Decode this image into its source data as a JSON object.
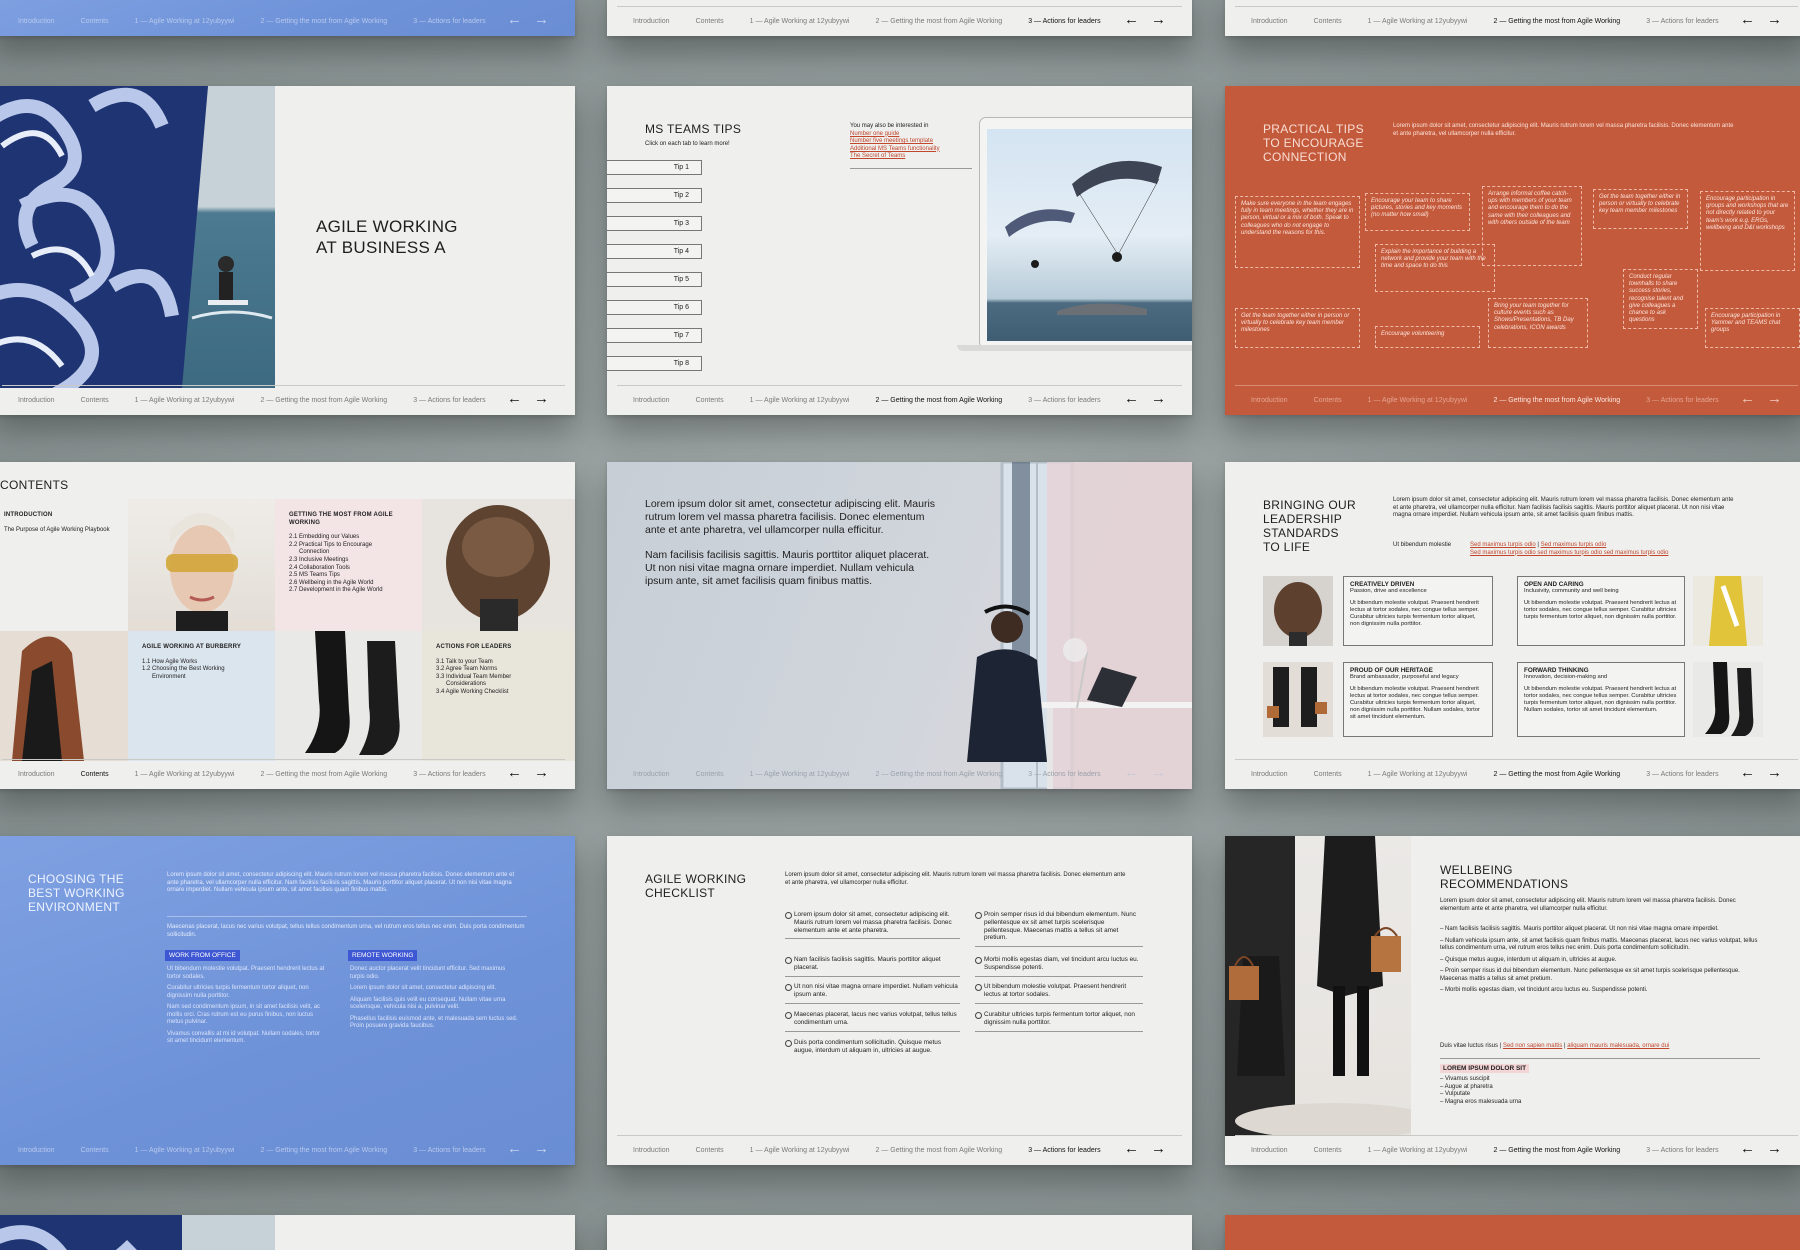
{
  "nav": {
    "items": [
      "Introduction",
      "Contents",
      "1 — Agile Working at 12yubyywi",
      "2 — Getting the most from Agile Working",
      "3 — Actions for leaders"
    ],
    "prev_icon": "arrow-left-icon",
    "next_icon": "arrow-right-icon"
  },
  "colors": {
    "orange": "#c45a3c",
    "blue": "#7496dc",
    "link": "#c0462c"
  },
  "cover": {
    "title_line1": "AGILE WORKING",
    "title_line2": "AT BUSINESS A"
  },
  "teams": {
    "title": "MS TEAMS TIPS",
    "subtitle": "Click on each tab to learn more!",
    "tips": [
      "Tip 1",
      "Tip 2",
      "Tip 3",
      "Tip 4",
      "Tip 5",
      "Tip 6",
      "Tip 7",
      "Tip 8"
    ],
    "interest_label": "You may also be interested in",
    "links": [
      "Number one guide",
      "Number five meetings template",
      "Additional MS Teams functionality",
      "The Secret of Teams"
    ]
  },
  "practical": {
    "title_line1": "PRACTICAL TIPS",
    "title_line2": "TO ENCOURAGE",
    "title_line3": "CONNECTION",
    "intro": "Lorem ipsum dolor sit amet, consectetur adipiscing elit. Mauris rutrum lorem vel massa pharetra facilisis. Donec elementum ante et ante pharetra, vel ullamcorper nulla efficitur.",
    "boxes": [
      "Make sure everyone in the team engages fully in team meetings, whether they are in person, virtual or a mix of both. Speak to colleagues who do not engage to understand the reasons for this.",
      "Encourage your team to share pictures, stories and key moments (no matter how small)",
      "Arrange informal coffee catch-ups with members of your team and encourage them to do the same with their colleagues and with others outside of the team",
      "Get the team together either in person or virtually to celebrate key team member milestones",
      "Encourage participation in groups and workshops that are not directly related to your team's work e.g. ERGs, wellbeing and D&I workshops",
      "Explain the importance of building a network and provide your team with the time and space to do this",
      "Conduct regular townhalls to share success stories, recognise talent and give colleagues a chance to ask questions",
      "Get the team together either in person or virtually to celebrate key team member milestones",
      "Bring your team together for culture events such as Shows/Presentations, TB Day celebrations, ICON awards",
      "Encourage volunteering",
      "Encourage participation in Yammer and TEAMS chat groups"
    ]
  },
  "contents": {
    "title": "CONTENTS",
    "intro_head": "INTRODUCTION",
    "intro_items": [
      "The Purpose of Agile Working Playbook"
    ],
    "getting_head": "GETTING THE MOST FROM AGILE WORKING",
    "getting_items": [
      "2.1 Embedding our Values",
      "2.2 Practical Tips to Encourage",
      "Connection",
      "2.3 Inclusive Meetings",
      "2.4 Collaboration Tools",
      "2.5 MS Teams Tips",
      "2.6 Wellbeing in the Agile World",
      "2.7 Development in the Agile World"
    ],
    "agile_head": "AGILE WORKING AT BURBERRY",
    "agile_items": [
      "1.1 How Agile Works",
      "1.2 Choosing the Best Working",
      "Environment"
    ],
    "actions_head": "ACTIONS FOR LEADERS",
    "actions_items": [
      "3.1 Talk to your Team",
      "3.2 Agree Team Norms",
      "3.3 Individual Team Member",
      "Considerations",
      "3.4 Agile Working Checklist"
    ]
  },
  "quote": {
    "p1": "Lorem ipsum dolor sit amet, consectetur adipiscing elit. Mauris rutrum lorem vel massa pharetra facilisis. Donec elementum ante et ante pharetra, vel ullamcorper nulla efficitur.",
    "p2": "Nam facilisis facilisis sagittis. Mauris porttitor aliquet placerat. Ut non nisi vitae magna ornare imperdiet. Nullam vehicula ipsum ante, sit amet facilisis quam finibus mattis."
  },
  "leadership": {
    "title_line1": "BRINGING OUR",
    "title_line2": "LEADERSHIP",
    "title_line3": "STANDARDS",
    "title_line4": "TO LIFE",
    "intro": "Lorem ipsum dolor sit amet, consectetur adipiscing elit. Mauris rutrum lorem vel massa pharetra facilisis. Donec elementum ante et ante pharetra, vel ullamcorper nulla efficitur. Nam facilisis facilisis sagittis. Mauris porttitor aliquet placerat. Ut non nisi vitae magna ornare imperdiet. Nullam vehicula ipsum ante, sit amet facilisis quam finibus mattis.",
    "ref_label": "Ut bibendum molestie",
    "links": [
      "Sed maximus turpis odio",
      "Sed maximus turpis odio",
      "Sed maximus turpis odio sed maximus turpis odio sed maximus turpis odio"
    ],
    "box_body": "Ut bibendum molestie volutpat. Praesent hendrerit lectus at tortor sodales, nec congue tellus semper. Curabitur ultricies turpis fermentum tortor aliquet, non dignissim nulla porttitor.",
    "box_body2": "Ut bibendum molestie volutpat. Praesent hendrerit lectus at tortor sodales, nec congue tellus semper. Curabitur ultricies turpis fermentum tortor aliquet, non dignissim nulla porttitor. Nullam sodales, tortor sit amet tincidunt elementum.",
    "boxes": [
      {
        "title": "CREATIVELY DRIVEN",
        "sub": "Passion, drive and excellence"
      },
      {
        "title": "OPEN AND CARING",
        "sub": "Inclusivity, community and well being"
      },
      {
        "title": "PROUD OF OUR HERITAGE",
        "sub": "Brand ambassador, purposeful and legacy"
      },
      {
        "title": "FORWARD THINKING",
        "sub": "Innovation, decision-making and"
      }
    ]
  },
  "environment": {
    "title_line1": "CHOOSING THE",
    "title_line2": "BEST WORKING",
    "title_line3": "ENVIRONMENT",
    "p1": "Lorem ipsum dolor sit amet, consectetur adipiscing elit. Mauris rutrum lorem vel massa pharetra facilisis. Donec elementum ante et ante pharetra, vel ullamcorper nulla efficitur. Nam facilisis facilisis sagittis. Mauris porttitor aliquet placerat. Ut non nisi vitae magna ornare imperdiet. Nullam vehicula ipsum ante, sit amet facilisis quam finibus mattis.",
    "p2": "Maecenas placerat, lacus nec varius volutpat, tellus tellus condimentum urna, vel rutrum eros tellus nec enim. Duis porta condimentum sollicitudin.",
    "office_label": "WORK FROM OFFICE",
    "remote_label": "REMOTE WORKING",
    "office_items": [
      "Ut bibendum molestie volutpat. Praesent hendrerit lectus at tortor sodales.",
      "Curabitur ultricies turpis fermentum tortor aliquet, non dignissim nulla porttitor.",
      "Nam sed condimentum ipsum, in sit amet facilisis velit, ac mollis orci. Cras rutrum est eu purus finibus, non luctus metus pulvinar.",
      "Vivamus convallis at mi id volutpat. Nullam sodales, tortor sit amet tincidunt elementum."
    ],
    "remote_items": [
      "Donec auctor placerat velit tincidunt efficitur. Sed maximus turpis odio.",
      "Lorem ipsum dolor sit amet, consectetur adipiscing elit.",
      "Aliquam facilisis quis velit eu consequat. Nullam vitae urna scelerisque, vehicula nisi a, pulvinar velit.",
      "Phasellus facilisis euismod ante, et malesuada sem luctus sed. Proin posuere gravida faucibus."
    ]
  },
  "checklist": {
    "title_line1": "AGILE WORKING",
    "title_line2": "CHECKLIST",
    "intro": "Lorem ipsum dolor sit amet, consectetur adipiscing elit. Mauris rutrum lorem vel massa pharetra facilisis. Donec elementum ante et ante pharetra, vel ullamcorper nulla efficitur.",
    "left": [
      "Lorem ipsum dolor sit amet, consectetur adipiscing elit. Mauris rutrum lorem vel massa pharetra facilisis. Donec elementum ante et ante pharetra.",
      "Nam facilisis facilisis sagittis. Mauris porttitor aliquet placerat.",
      "Ut non nisi vitae magna ornare imperdiet. Nullam vehicula ipsum ante.",
      "Maecenas placerat, lacus nec varius volutpat, tellus tellus condimentum urna.",
      "Duis porta condimentum sollicitudin. Quisque metus augue, interdum ut aliquam in, ultricies at augue."
    ],
    "right": [
      "Proin semper risus id dui bibendum elementum. Nunc pellentesque ex sit amet turpis scelerisque pellentesque. Maecenas mattis a tellus sit amet pretium.",
      "Morbi mollis egestas diam, vel tincidunt arcu luctus eu. Suspendisse potenti.",
      "Ut bibendum molestie volutpat. Praesent hendrerit lectus at tortor sodales.",
      "Curabitur ultricies turpis fermentum tortor aliquet, non dignissim nulla porttitor."
    ]
  },
  "wellbeing": {
    "title_line1": "WELLBEING",
    "title_line2": "RECOMMENDATIONS",
    "intro": "Lorem ipsum dolor sit amet, consectetur adipiscing elit. Mauris rutrum lorem vel massa pharetra facilisis. Donec elementum ante et ante pharetra, vel ullamcorper nulla efficitur.",
    "items": [
      "Nam facilisis facilisis sagittis. Mauris porttitor aliquet placerat. Ut non nisi vitae magna ornare imperdiet.",
      "Nullam vehicula ipsum ante, sit amet facilisis quam finibus mattis. Maecenas placerat, lacus nec varius volutpat, tellus tellus condimentum urna, vel rutrum eros tellus nec enim. Duis porta condimentum sollicitudin.",
      "Quisque metus augue, interdum ut aliquam in, ultricies at augue.",
      "Proin semper risus id dui bibendum elementum. Nunc pellentesque ex sit amet turpis scelerisque pellentesque. Maecenas mattis a tellus sit amet pretium.",
      "Morbi mollis egestas diam, vel tincidunt arcu luctus eu. Suspendisse potenti."
    ],
    "ref_label": "Duis vitae luctus risus",
    "links": [
      "Sed non sapien mattis",
      "aliquam mauris malesuada, ornare dui"
    ],
    "lorem_label": "LOREM IPSUM DOLOR SIT",
    "bullets": [
      "– Vivamus suscipit",
      "– Augue at pharetra",
      "– Vulputate",
      "– Magna eros malesuada urna"
    ]
  }
}
